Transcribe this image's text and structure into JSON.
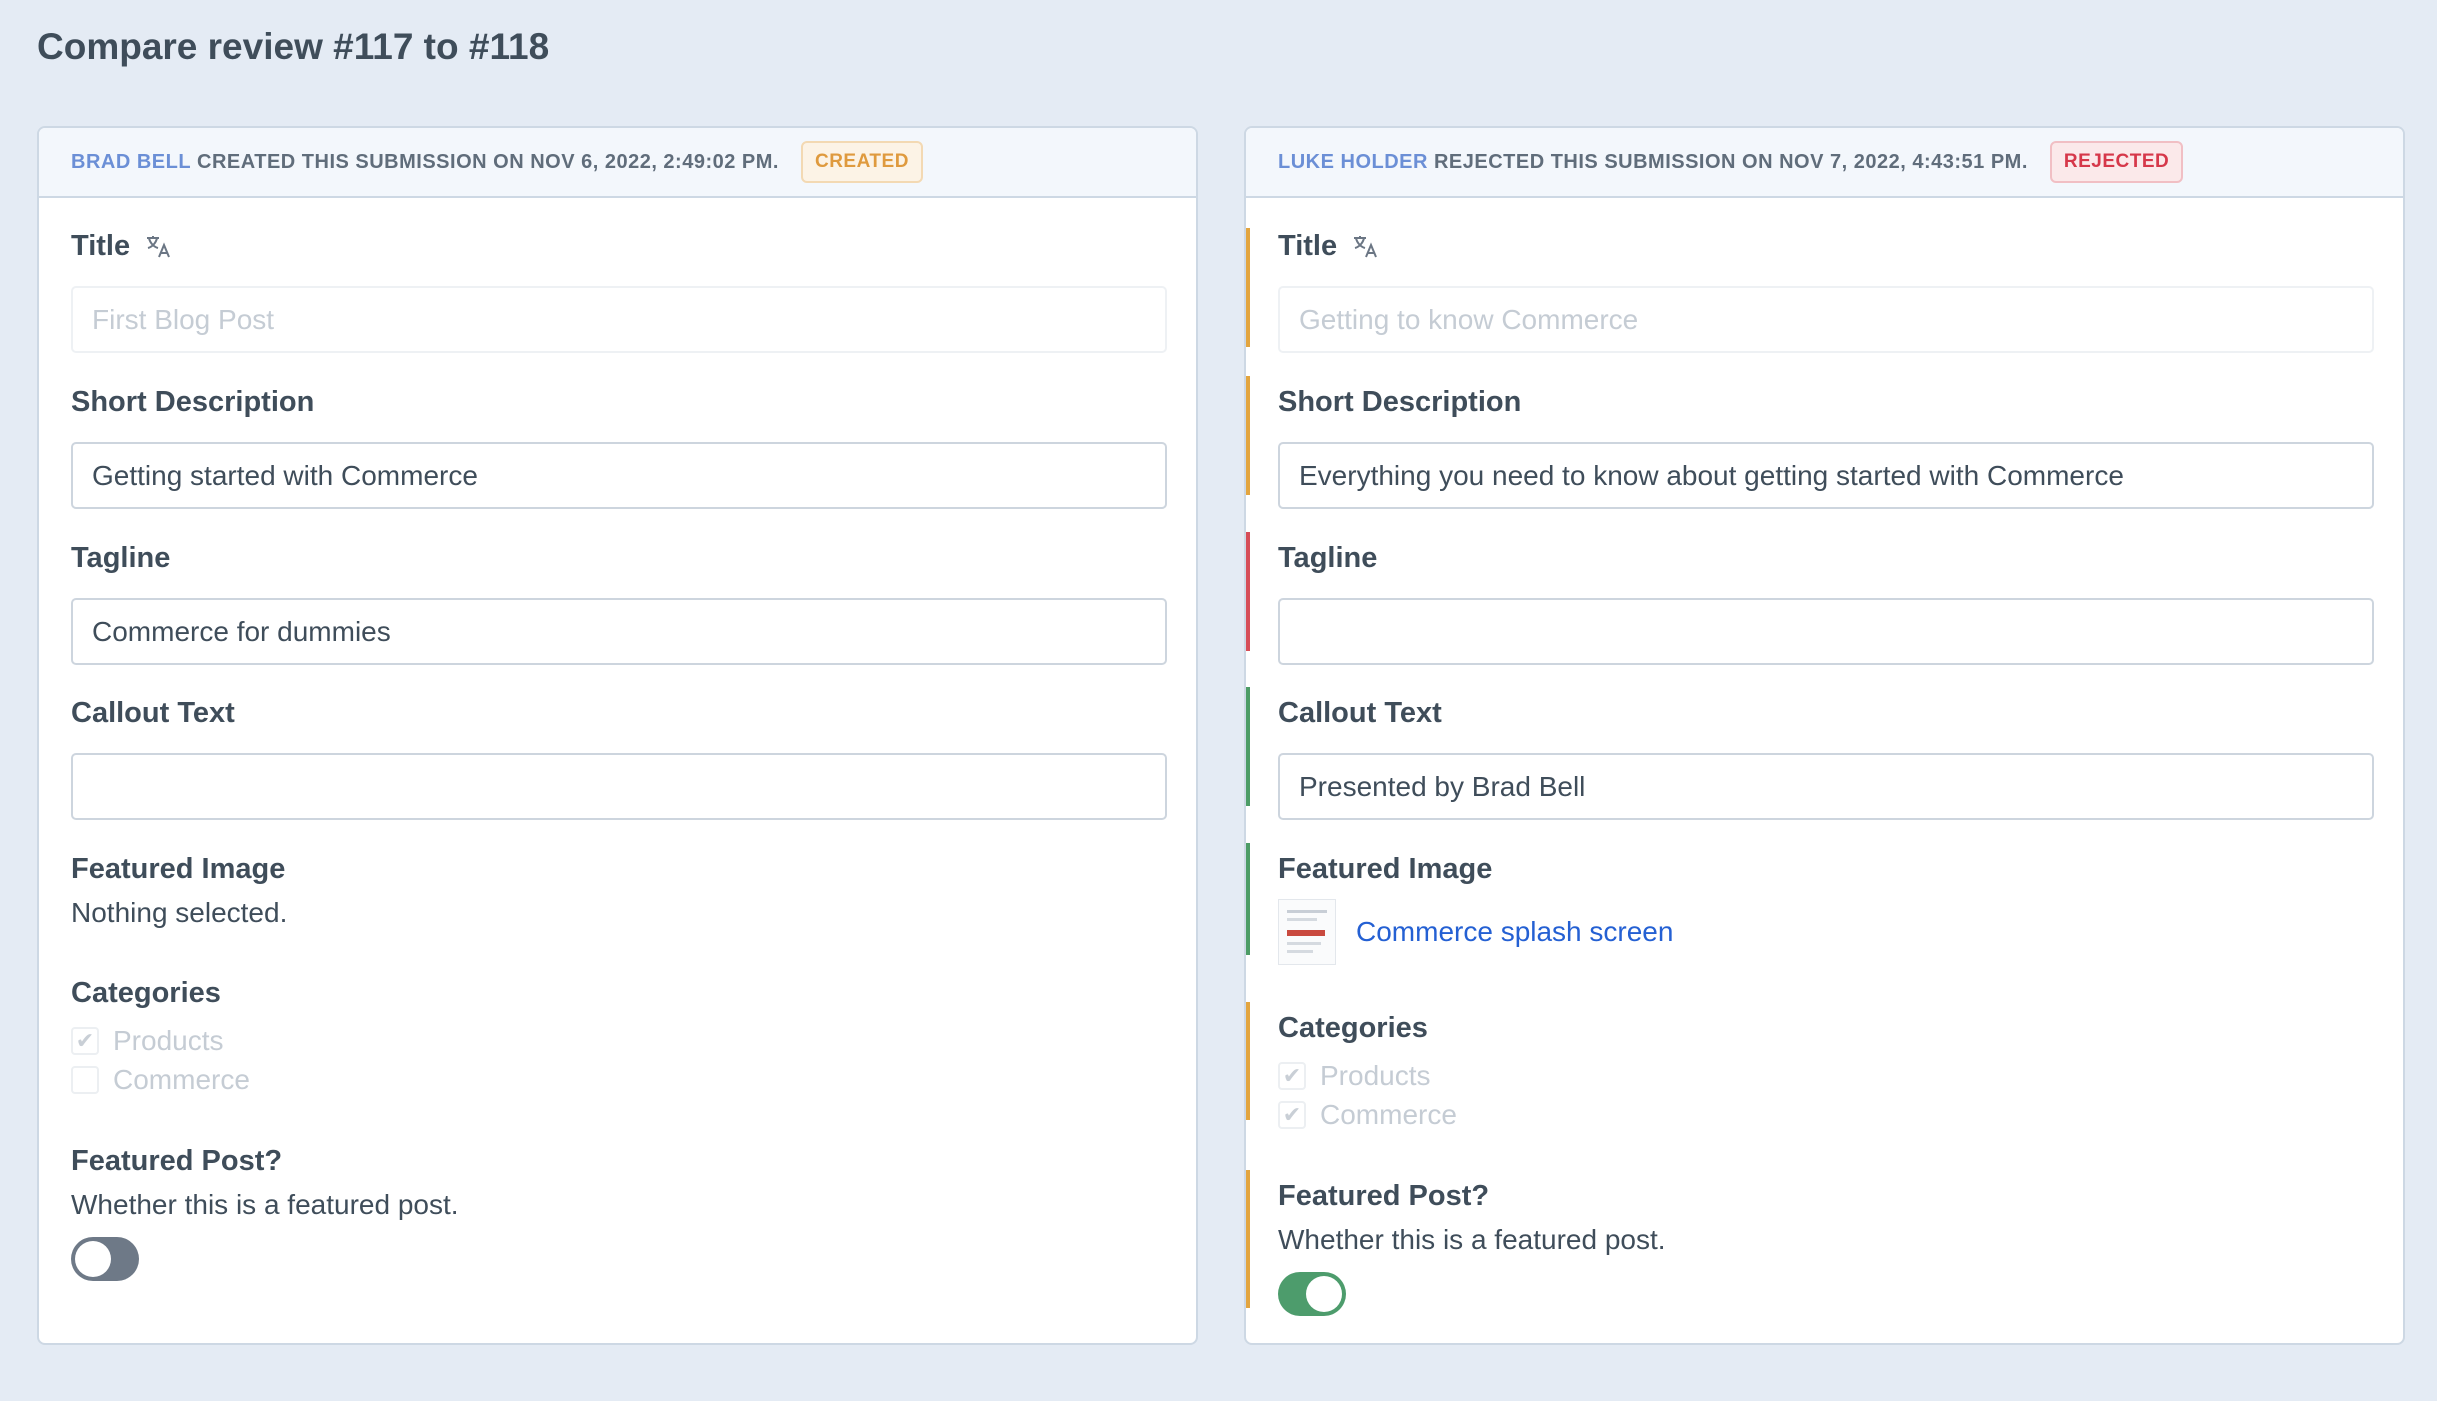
{
  "page": {
    "title": "Compare review #117 to #118"
  },
  "left": {
    "header": {
      "user": "Brad Bell",
      "action": "created this submission on Nov 6, 2022, 2:49:02 PM.",
      "badge": "Created"
    },
    "fields": {
      "title": {
        "label": "Title",
        "value": "First Blog Post"
      },
      "short_description": {
        "label": "Short Description",
        "value": "Getting started with Commerce"
      },
      "tagline": {
        "label": "Tagline",
        "value": "Commerce for dummies"
      },
      "callout_text": {
        "label": "Callout Text",
        "value": ""
      },
      "featured_image": {
        "label": "Featured Image",
        "value": "Nothing selected."
      },
      "categories": {
        "label": "Categories",
        "options": [
          {
            "label": "Products",
            "checked": true
          },
          {
            "label": "Commerce",
            "checked": false
          }
        ]
      },
      "featured_post": {
        "label": "Featured Post?",
        "instructions": "Whether this is a featured post.",
        "on": false
      }
    }
  },
  "right": {
    "header": {
      "user": "Luke Holder",
      "action": "rejected this submission on Nov 7, 2022, 4:43:51 PM.",
      "badge": "Rejected"
    },
    "fields": {
      "title": {
        "label": "Title",
        "value": "Getting to know Commerce",
        "change": "modified"
      },
      "short_description": {
        "label": "Short Description",
        "value": "Everything you need to know about getting started with Commerce",
        "change": "modified"
      },
      "tagline": {
        "label": "Tagline",
        "value": "",
        "change": "removed"
      },
      "callout_text": {
        "label": "Callout Text",
        "value": "Presented by Brad Bell",
        "change": "added"
      },
      "featured_image": {
        "label": "Featured Image",
        "asset": "Commerce splash screen",
        "change": "added"
      },
      "categories": {
        "label": "Categories",
        "change": "modified",
        "options": [
          {
            "label": "Products",
            "checked": true
          },
          {
            "label": "Commerce",
            "checked": true
          }
        ]
      },
      "featured_post": {
        "label": "Featured Post?",
        "instructions": "Whether this is a featured post.",
        "on": true,
        "change": "modified"
      }
    }
  },
  "icons": {
    "translate": "translate-icon",
    "check": "check-icon"
  },
  "colors": {
    "modified": "#e3a53f",
    "removed": "#d64d57",
    "added": "#4d9c66",
    "link": "#2460d3"
  }
}
